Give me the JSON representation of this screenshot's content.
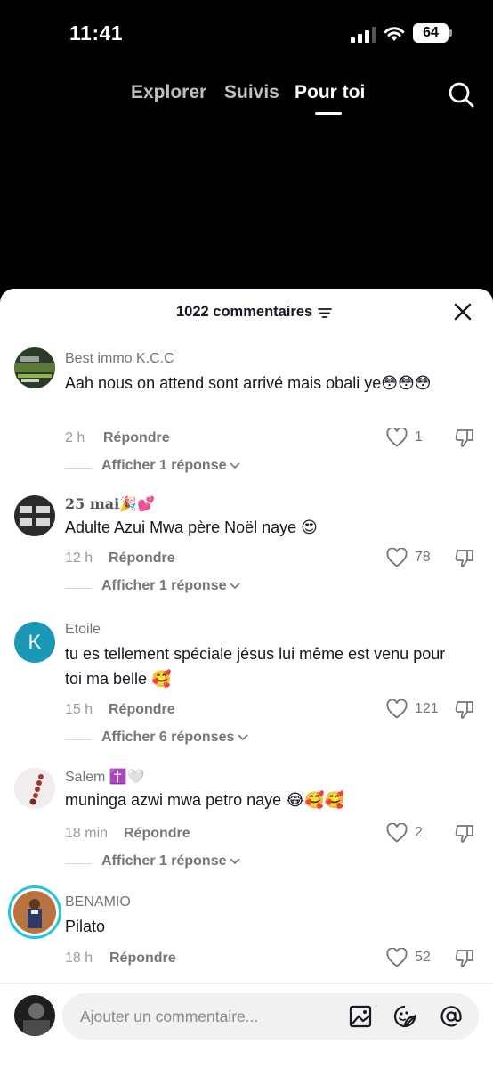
{
  "status": {
    "time": "11:41",
    "battery": "64"
  },
  "nav": {
    "tabs": [
      "Explorer",
      "Suivis",
      "Pour toi"
    ]
  },
  "sheet": {
    "title": "1022 commentaires"
  },
  "comments": [
    {
      "user": "Best immo K.C.C",
      "text": "Aah nous on attend sont arrivé mais obali ye😳😳😳",
      "time": "2 h",
      "reply": "Répondre",
      "likes": "1",
      "more": "Afficher 1 réponse"
    },
    {
      "user": "25 mai🎉💕",
      "text": "Adulte Azui Mwa père Noël naye 😍",
      "time": "12 h",
      "reply": "Répondre",
      "likes": "78",
      "more": "Afficher 1 réponse"
    },
    {
      "user": "Etoile",
      "avatar_letter": "K",
      "text": "tu es tellement spéciale jésus lui même est venu pour toi ma belle 🥰",
      "time": "15 h",
      "reply": "Répondre",
      "likes": "121",
      "more": "Afficher 6 réponses"
    },
    {
      "user": "Salem ✝️🤍",
      "text": "muninga azwi mwa petro naye 😂🥰🥰",
      "time": "18 min",
      "reply": "Répondre",
      "likes": "2",
      "more": "Afficher 1 réponse"
    },
    {
      "user": "BENAMIO",
      "text": "Pilato",
      "time": "18 h",
      "reply": "Répondre",
      "likes": "52"
    }
  ],
  "input": {
    "placeholder": "Ajouter un commentaire..."
  },
  "colors": {
    "accent_avatar_k": "#1a98b5",
    "ring": "#23c4e0"
  }
}
